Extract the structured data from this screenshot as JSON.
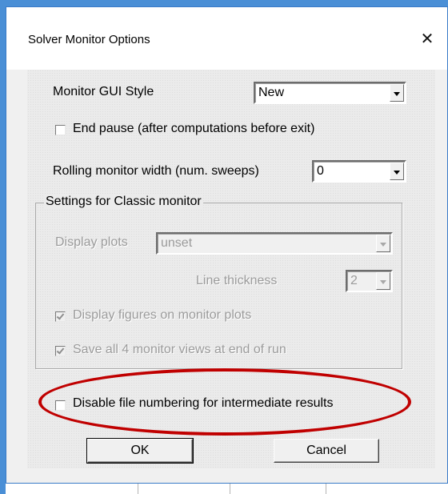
{
  "window": {
    "title": "Solver Monitor Options",
    "close_glyph": "✕"
  },
  "monitor_gui_style": {
    "label": "Monitor GUI Style",
    "value": "New"
  },
  "end_pause": {
    "label": "End pause (after computations before exit)",
    "checked": false
  },
  "rolling_width": {
    "label": "Rolling monitor width (num. sweeps)",
    "value": "0"
  },
  "classic_group": {
    "title": "Settings for Classic monitor",
    "display_plots": {
      "label": "Display plots",
      "value": "unset"
    },
    "line_thickness": {
      "label": "Line thickness",
      "value": "2"
    },
    "display_figures": {
      "label": "Display figures on monitor plots",
      "checked": true
    },
    "save_views": {
      "label": "Save all 4 monitor views at end of run",
      "checked": true
    }
  },
  "disable_numbering": {
    "label": "Disable file numbering for intermediate results",
    "checked": false
  },
  "buttons": {
    "ok": "OK",
    "cancel": "Cancel"
  },
  "colors": {
    "highlight": "#c00000",
    "background": "#4a8fd6"
  },
  "icons": [
    "close-icon",
    "dropdown-arrow-icon",
    "checkbox-icon"
  ]
}
